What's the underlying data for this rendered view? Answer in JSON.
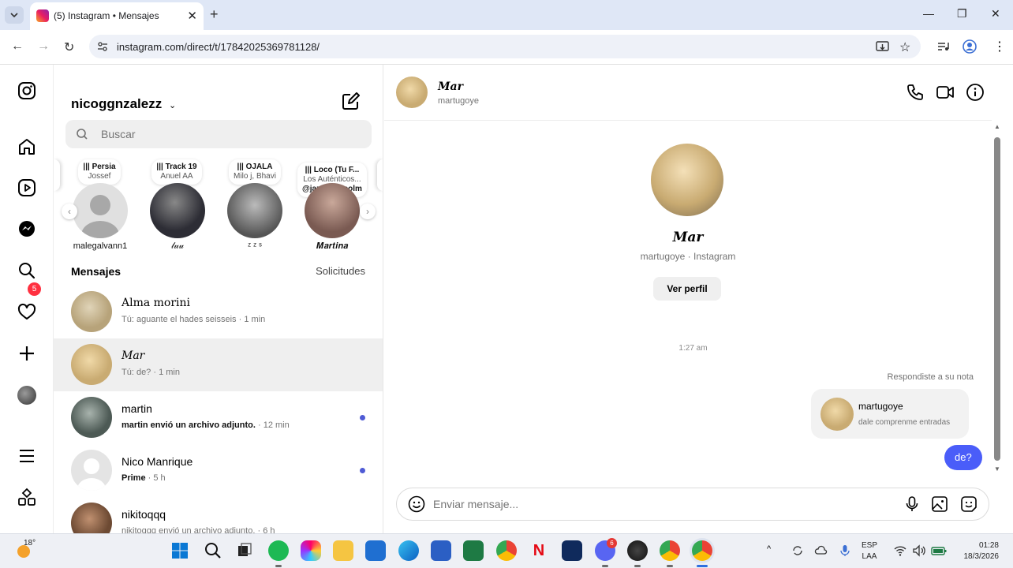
{
  "browser": {
    "tab_title": "(5) Instagram • Mensajes",
    "url": "instagram.com/direct/t/17842025369781128/"
  },
  "rail": {
    "notifications_badge": "5",
    "icons": [
      "instagram-logo-icon",
      "home-icon",
      "reels-icon",
      "messenger-icon",
      "search-icon",
      "heart-icon",
      "plus-icon",
      "profile-avatar",
      "menu-icon",
      "apps-icon"
    ]
  },
  "inbox": {
    "username": "nicoggnzalezz",
    "search_placeholder": "Buscar",
    "notes": [
      {
        "title": "||| Persia",
        "sub": "Jossef",
        "name": "malegalvann1",
        "color": "#bdbdbd"
      },
      {
        "title": "||| Track 19",
        "sub": "Anuel AA",
        "name": "𝓁𝓊𝓊",
        "color": "#2d2d35"
      },
      {
        "title": "||| OJALA",
        "sub": "Milo j, Bhavi",
        "name": "ᶻ ᶻ ˢ",
        "color": "#6b6b6b"
      },
      {
        "title": "||| Loco (Tu F...",
        "sub": "Los Auténticos...",
        "extra": "@jazchuu_colm",
        "name": "𝑴𝒂𝒓𝒕𝒊𝒏𝒂",
        "color": "#7a5a52"
      }
    ],
    "messages_heading": "Mensajes",
    "requests_label": "Solicitudes",
    "conversations": [
      {
        "name": "Alma morini",
        "preview": "Tú: aguante el hades seisseis",
        "time": "· 1 min",
        "unread": false,
        "selected": false,
        "color": "#b7a37a"
      },
      {
        "name": "𝑀𝑎𝑟",
        "preview": "Tú: de?",
        "time": "· 1 min",
        "unread": false,
        "selected": true,
        "color": "#c9ab72"
      },
      {
        "name": "martin",
        "preview": "martin envió un archivo adjunto.",
        "time": "· 12 min",
        "unread": true,
        "selected": false,
        "color": "#4d5a55"
      },
      {
        "name": "Nico Manrique",
        "preview": "Prime",
        "time": "· 5 h",
        "unread": true,
        "selected": false,
        "color": "#d8d8d8"
      },
      {
        "name": "nikitoqqq",
        "preview": "nikitoqqq envió un archivo adjunto.",
        "time": "· 6 h",
        "unread": false,
        "selected": false,
        "color": "#6d4a33"
      }
    ]
  },
  "thread": {
    "name": "𝑴𝒂𝒓",
    "username": "martugoye",
    "profile_sub": "martugoye · Instagram",
    "view_profile": "Ver perfil",
    "timestamp": "1:27 am",
    "replied_note": "Respondiste a su nota",
    "note_user": "martugoye",
    "note_text": "dale comprenme entradas",
    "sent_message": "de?",
    "composer_placeholder": "Enviar mensaje..."
  },
  "taskbar": {
    "temperature": "18°",
    "lang1": "ESP",
    "lang2": "LAA",
    "time": "01:28",
    "date": "18/3/2026",
    "discord_badge": "6"
  }
}
